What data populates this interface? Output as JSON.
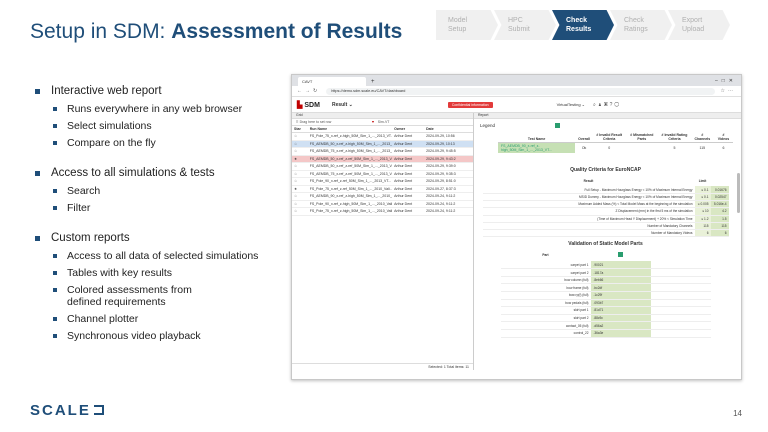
{
  "title": {
    "prefix": "Setup in SDM: ",
    "bold": "Assessment of Results"
  },
  "steps": [
    {
      "label": "Model\nSetup",
      "active": false
    },
    {
      "label": "HPC\nSubmit",
      "active": false
    },
    {
      "label": "Check\nResults",
      "active": true
    },
    {
      "label": "Check\nRatings",
      "active": false
    },
    {
      "label": "Export\nUpload",
      "active": false
    }
  ],
  "bullets": {
    "web": "Interactive web report",
    "web_items": [
      "Runs everywhere in any web browser",
      "Select simulations",
      "Compare on the fly"
    ],
    "access": "Access to all simulations & tests",
    "access_items": [
      "Search",
      "Filter"
    ],
    "custom": "Custom reports",
    "custom_items": [
      "Access to all data of selected simulations",
      "Tables with key results",
      "Colored assessments from\ndefined requirements",
      "Channel plotter",
      "Synchronous video playback"
    ]
  },
  "logo": "SCALE",
  "page_number": "14",
  "browser": {
    "tab_title": "CAVT",
    "url": "https://demo.sdm.scale.eu/CAVT/dashboard",
    "brand": "SDM",
    "brand_sub": "SCALE",
    "result_menu": "Result",
    "confidential": "Confidential information",
    "user": "VirtualTesting",
    "left_tab": "Grid",
    "drop_hint": "Drag here to set row",
    "filter_text": "Sim-VT",
    "cols": {
      "star": "Star",
      "run": "Run Name",
      "owner": "Owner",
      "date": "Date"
    },
    "rows": [
      {
        "name": "FS_Pole_75_x-ref_z-high_50M_Sim_1_..._2013_VT...",
        "owner": "Arthur Dent",
        "date": "2024-09-29, 10:56",
        "hl": "",
        "star": "☆"
      },
      {
        "name": "FS_AEMDB_50_x-ref_z-high_50M_Sim_1_..._2013_V...",
        "owner": "Arthur Dent",
        "date": "2024-09-29, 10:13",
        "hl": "sel",
        "star": "☆"
      },
      {
        "name": "FS_AEMDB_75_x-ref_z-high_50M_Sim_1_..._2013_V...",
        "owner": "Arthur Dent",
        "date": "2024-09-29, 9:45:5",
        "hl": "",
        "star": "☆"
      },
      {
        "name": "FS_AEMDB_50_x-ref_z-ref_50M_Sim_1_..._2013_V...",
        "owner": "Arthur Dent",
        "date": "2024-09-29, 9:43:2",
        "hl": "hl",
        "star": "★"
      },
      {
        "name": "FS_AEMDB_50_x-ref_z-ref_50M_Sim_1_..._2013_V...",
        "owner": "Arthur Dent",
        "date": "2024-09-29, 9:39:0",
        "hl": "",
        "star": "☆"
      },
      {
        "name": "FS_AEMDB_75_x-ref_z-ref_50M_Sim_1_..._2013_V...",
        "owner": "Arthur Dent",
        "date": "2024-09-29, 9:35:3",
        "hl": "",
        "star": "☆"
      },
      {
        "name": "FS_Pole_90_x-ref_z-ref_50M_Sim_1_..._2013_VT...",
        "owner": "Arthur Dent",
        "date": "2024-09-29, 8:51:0",
        "hl": "",
        "star": "☆"
      },
      {
        "name": "FS_Pole_75_x-ref_z-ref_50M_Sim_1_..._2010_Vali...",
        "owner": "Arthur Dent",
        "date": "2024-09-27, 8:37:3",
        "hl": "",
        "star": "★"
      },
      {
        "name": "FS_AEMDB_90_x-ref_z-high_50M_Sim_1_..._2010_...",
        "owner": "Arthur Dent",
        "date": "2024-09-24, 9:11:2",
        "hl": "",
        "star": "☆"
      },
      {
        "name": "FS_Pole_90_x-ref_z-high_50M_Sim_1_..._2010_Vali...",
        "owner": "Arthur Dent",
        "date": "2024-09-24, 9:11:2",
        "hl": "",
        "star": "☆"
      },
      {
        "name": "FS_Pole_75_x-ref_z-high_50M_Sim_1_..._2010_Vali...",
        "owner": "Arthur Dent",
        "date": "2024-09-24, 9:11:2",
        "hl": "",
        "star": "☆"
      }
    ],
    "footer": "Selected: 1   Total items: 11",
    "report_tab": "Report",
    "legend": "Legend",
    "summary": {
      "headers": [
        "Test Name",
        "Overall",
        "# Invalid Result Criteria",
        "# Mismatched Parts",
        "# Invalid Rating Criteria",
        "# Channels",
        "# Videos"
      ],
      "row": [
        "FS_AEMDB_90_x-ref_z-high_50M_Sim_1_..._2013_VT...",
        "Ok",
        "0",
        "",
        "5",
        "115",
        "6"
      ]
    },
    "quality": {
      "title": "Quality Criteria for EuroNCAP",
      "headers": [
        "Result",
        "Limit",
        ""
      ],
      "rows": [
        [
          "Full Setup - Maximum Hourglass Energy < 10% of Maximum Internal Energy",
          "≤ 0.1",
          "0.01676"
        ],
        [
          "MSID Dummy - Maximum Hourglass Energy < 10% of Maximum Internal Energy",
          "≤ 0.1",
          "0.02547"
        ],
        [
          "Maximum Added Mass (%) < Total Model Mass at the beginning of the simulation",
          "≤ 0.005",
          "5.016e-4"
        ],
        [
          "Z Displacement (mm) in the first 5 ms of the simulation",
          "≤ 10",
          "4.2"
        ],
        [
          "(Time of Maximum Head Y Displacement) + 20% < Simulation Time",
          "≤ 1.2",
          "1.5"
        ],
        [
          "Number of Mandatory Channels",
          "115",
          "115"
        ],
        [
          "Number of Mandatory Videos",
          "6",
          "6"
        ]
      ]
    },
    "validation": {
      "title": "Validation of Static Model Parts",
      "header": "Part",
      "rows": [
        [
          "carpet part 1",
          ".90021"
        ],
        [
          "carpet part 2",
          ".1817a"
        ],
        [
          "bow column (full)",
          ".8eb66"
        ],
        [
          "bow frame (full)",
          ".bc2df"
        ],
        [
          "bow rp(f) (full)",
          ".1c29f"
        ],
        [
          "bow pedals (full)",
          ".093b7"
        ],
        [
          "skirt part 1",
          ".81d71"
        ],
        [
          "skirt part 2",
          ".88c9c"
        ],
        [
          "contact_05 (full)",
          ".d56a2"
        ],
        [
          "control_22",
          ".36a3e"
        ]
      ]
    }
  }
}
